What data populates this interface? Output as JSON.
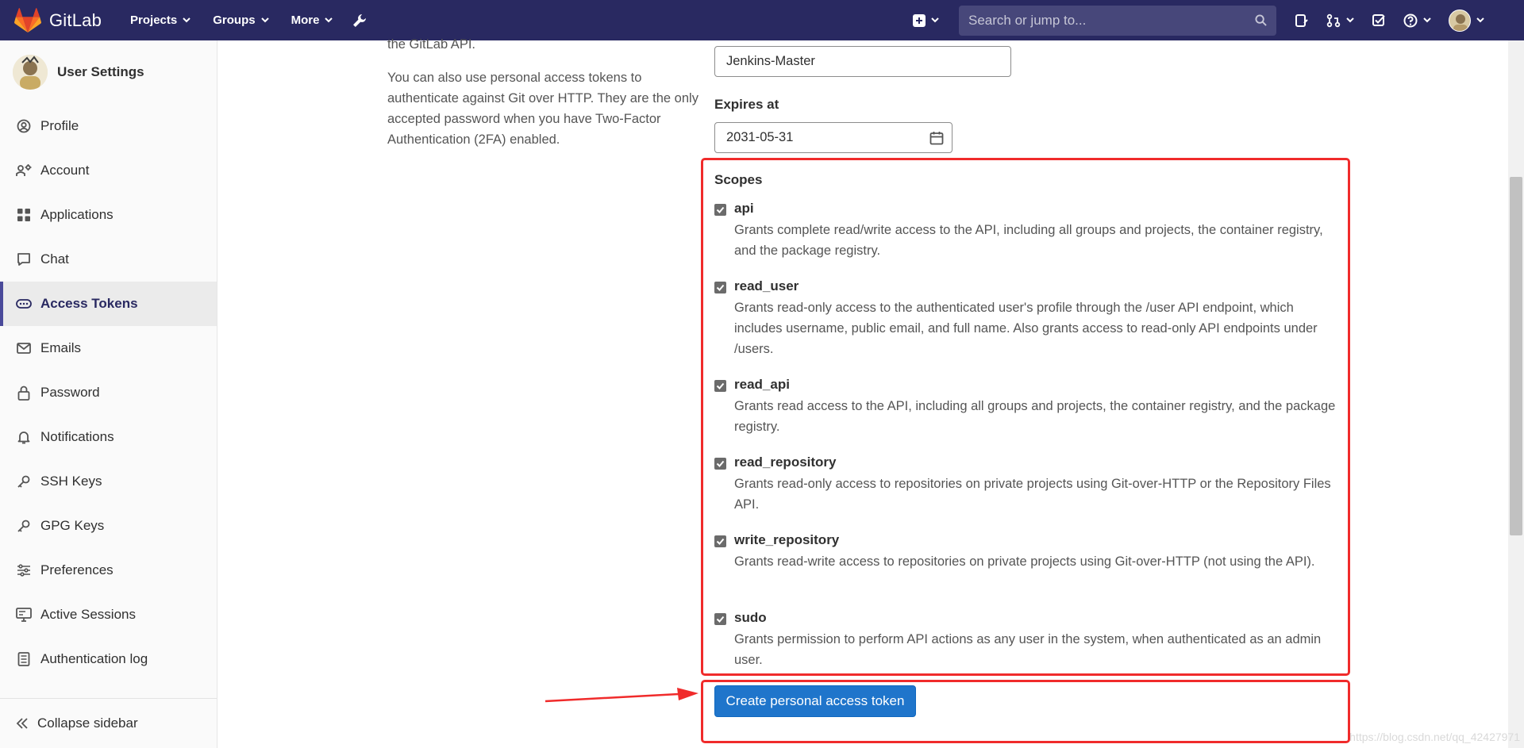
{
  "topbar": {
    "brand": "GitLab",
    "nav": [
      "Projects",
      "Groups",
      "More"
    ],
    "search_placeholder": "Search or jump to..."
  },
  "sidebar": {
    "title": "User Settings",
    "items": [
      {
        "label": "Profile",
        "icon": "profile-icon",
        "active": false
      },
      {
        "label": "Account",
        "icon": "account-icon",
        "active": false
      },
      {
        "label": "Applications",
        "icon": "applications-icon",
        "active": false
      },
      {
        "label": "Chat",
        "icon": "chat-icon",
        "active": false
      },
      {
        "label": "Access Tokens",
        "icon": "token-icon",
        "active": true
      },
      {
        "label": "Emails",
        "icon": "mail-icon",
        "active": false
      },
      {
        "label": "Password",
        "icon": "lock-icon",
        "active": false
      },
      {
        "label": "Notifications",
        "icon": "bell-icon",
        "active": false
      },
      {
        "label": "SSH Keys",
        "icon": "key-icon",
        "active": false
      },
      {
        "label": "GPG Keys",
        "icon": "key-icon",
        "active": false
      },
      {
        "label": "Preferences",
        "icon": "preferences-icon",
        "active": false
      },
      {
        "label": "Active Sessions",
        "icon": "monitor-icon",
        "active": false
      },
      {
        "label": "Authentication log",
        "icon": "log-icon",
        "active": false
      }
    ],
    "collapse_label": "Collapse sidebar"
  },
  "main": {
    "intro_top": "the GitLab API.",
    "intro": "You can also use personal access tokens to authenticate against Git over HTTP. They are the only accepted password when you have Two-Factor Authentication (2FA) enabled.",
    "token_name_value": "Jenkins-Master",
    "expires_label": "Expires at",
    "expires_value": "2031-05-31",
    "scopes_title": "Scopes",
    "scopes": [
      {
        "name": "api",
        "checked": true,
        "desc": "Grants complete read/write access to the API, including all groups and projects, the container registry, and the package registry."
      },
      {
        "name": "read_user",
        "checked": true,
        "desc": "Grants read-only access to the authenticated user's profile through the /user API endpoint, which includes username, public email, and full name. Also grants access to read-only API endpoints under /users."
      },
      {
        "name": "read_api",
        "checked": true,
        "desc": "Grants read access to the API, including all groups and projects, the container registry, and the package registry."
      },
      {
        "name": "read_repository",
        "checked": true,
        "desc": "Grants read-only access to repositories on private projects using Git-over-HTTP or the Repository Files API."
      },
      {
        "name": "write_repository",
        "checked": true,
        "desc": "Grants read-write access to repositories on private projects using Git-over-HTTP (not using the API)."
      },
      {
        "name": "sudo",
        "checked": true,
        "desc": "Grants permission to perform API actions as any user in the system, when authenticated as an admin user."
      }
    ],
    "create_button": "Create personal access token"
  },
  "watermark": "https://blog.csdn.net/qq_42427971",
  "colors": {
    "topbar": "#292961",
    "primary": "#1f75cb",
    "highlight": "#f02b2b"
  }
}
